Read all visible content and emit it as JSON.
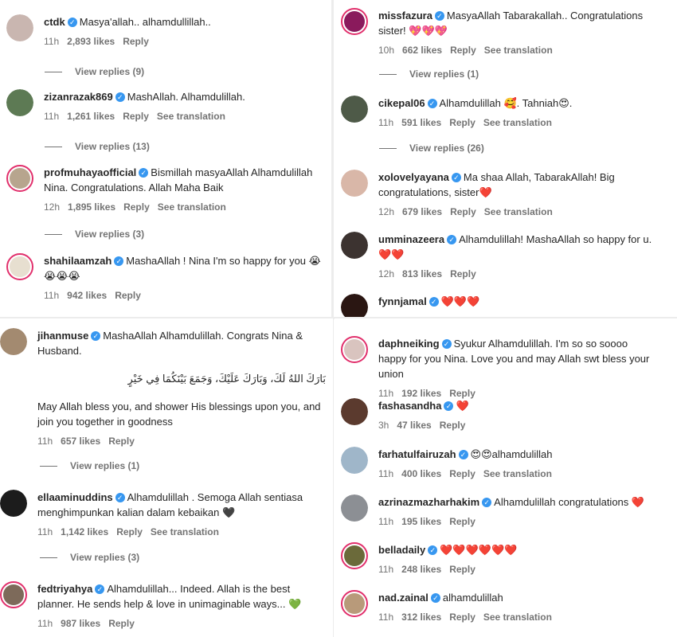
{
  "panels": {
    "p1": [
      {
        "user": "ctdk",
        "text": "Masya'allah.. alhamdullillah..",
        "time": "11h",
        "likes": "2,893 likes",
        "reply": "Reply",
        "view_replies": "View replies (9)",
        "avatar_color": "#c9b6b0"
      },
      {
        "user": "zizanrazak869",
        "text": "MashAllah. Alhamdulillah.",
        "time": "11h",
        "likes": "1,261 likes",
        "reply": "Reply",
        "translation": "See translation",
        "view_replies": "View replies (13)",
        "avatar_color": "#5d7a54"
      },
      {
        "user": "profmuhayaofficial",
        "text": "Bismillah masyaAllah Alhamdulillah Nina. Congratulations. Allah Maha Baik",
        "time": "12h",
        "likes": "1,895 likes",
        "reply": "Reply",
        "translation": "See translation",
        "view_replies": "View replies (3)",
        "avatar_color": "#b7a58e"
      },
      {
        "user": "shahilaamzah",
        "text": "MashaAllah ! Nina I'm so happy for you 😭😭😭😭",
        "time": "11h",
        "likes": "942 likes",
        "reply": "Reply",
        "avatar_color": "#e7dfd0"
      }
    ],
    "p2": [
      {
        "user": "missfazura",
        "text": "MasyaAllah Tabarakallah.. Congratulations sister! 💖💖💖",
        "time": "10h",
        "likes": "662 likes",
        "reply": "Reply",
        "translation": "See translation",
        "view_replies": "View replies (1)",
        "avatar_color": "#8a1a5c"
      },
      {
        "user": "cikepal06",
        "text": "Alhamdulillah 🥰. Tahniah😍.",
        "time": "11h",
        "likes": "591 likes",
        "reply": "Reply",
        "translation": "See translation",
        "view_replies": "View replies (26)",
        "avatar_color": "#4e5a48"
      },
      {
        "user": "xolovelyayana",
        "text": "Ma shaa Allah, TabarakAllah! Big congratulations, sister❤️",
        "time": "12h",
        "likes": "679 likes",
        "reply": "Reply",
        "translation": "See translation",
        "avatar_color": "#d9b7a8"
      },
      {
        "user": "umminazeera",
        "text": "Alhamdulillah! MashaAllah so happy for u. ❤️❤️",
        "time": "12h",
        "likes": "813 likes",
        "reply": "Reply",
        "avatar_color": "#3c3330"
      },
      {
        "user": "fynnjamal",
        "text": "❤️❤️❤️",
        "avatar_color": "#2a1612"
      }
    ],
    "p3": [
      {
        "user": "jihanmuse",
        "text": "MashaAllah Alhamdulillah. Congrats Nina & Husband.",
        "arabic": "بَارَكَ اللهُ لَكَ، وَبَارَكَ عَلَيْكَ، وَجَمَعَ بَيْنَكُمَا فِي خَيْرٍ",
        "text2": "May Allah bless you, and shower His blessings upon you, and join you together in goodness",
        "time": "11h",
        "likes": "657 likes",
        "reply": "Reply",
        "view_replies": "View replies (1)",
        "avatar_color": "#a38a70"
      },
      {
        "user": "ellaaminuddins",
        "text": "Alhamdulillah . Semoga Allah sentiasa menghimpunkan kalian dalam kebaikan 🖤",
        "time": "11h",
        "likes": "1,142 likes",
        "reply": "Reply",
        "translation": "See translation",
        "view_replies": "View replies (3)",
        "avatar_color": "#1c1c1c"
      },
      {
        "user": "fedtriyahya",
        "text": "Alhamdulillah... Indeed. Allah is the best planner. He sends help & love in unimaginable ways... 💚",
        "time": "11h",
        "likes": "987 likes",
        "reply": "Reply",
        "avatar_color": "#7d6a5a"
      }
    ],
    "p4": [
      {
        "user": "daphneiking",
        "text": "Syukur Alhamdulillah. I'm so so soooo happy for you Nina. Love you and may Allah swt bless your union",
        "time": "11h",
        "likes": "192 likes",
        "reply": "Reply",
        "avatar_color": "#d9c4bf"
      },
      {
        "user": "fashasandha",
        "text": "❤️",
        "time": "3h",
        "likes": "47 likes",
        "reply": "Reply",
        "avatar_color": "#5b3a2e"
      },
      {
        "user": "farhatulfairuzah",
        "text": "😍😍alhamdulillah",
        "time": "11h",
        "likes": "400 likes",
        "reply": "Reply",
        "translation": "See translation",
        "avatar_color": "#9fb6c9"
      },
      {
        "user": "azrinazmazharhakim",
        "text": "Alhamdulillah congratulations ❤️",
        "time": "11h",
        "likes": "195 likes",
        "reply": "Reply",
        "avatar_color": "#8c8f94"
      },
      {
        "user": "belladaily",
        "text": "❤️❤️❤️❤️❤️❤️",
        "time": "11h",
        "likes": "248 likes",
        "reply": "Reply",
        "avatar_color": "#6b6a3a"
      },
      {
        "user": "nad.zainal",
        "text": "alhamdulillah",
        "time": "11h",
        "likes": "312 likes",
        "reply": "Reply",
        "translation": "See translation",
        "avatar_color": "#b89a7a"
      }
    ]
  },
  "colors": {
    "verified": "#3797f0",
    "meta": "#737373",
    "ring": "#e1306c",
    "heart": "#ed4956"
  }
}
